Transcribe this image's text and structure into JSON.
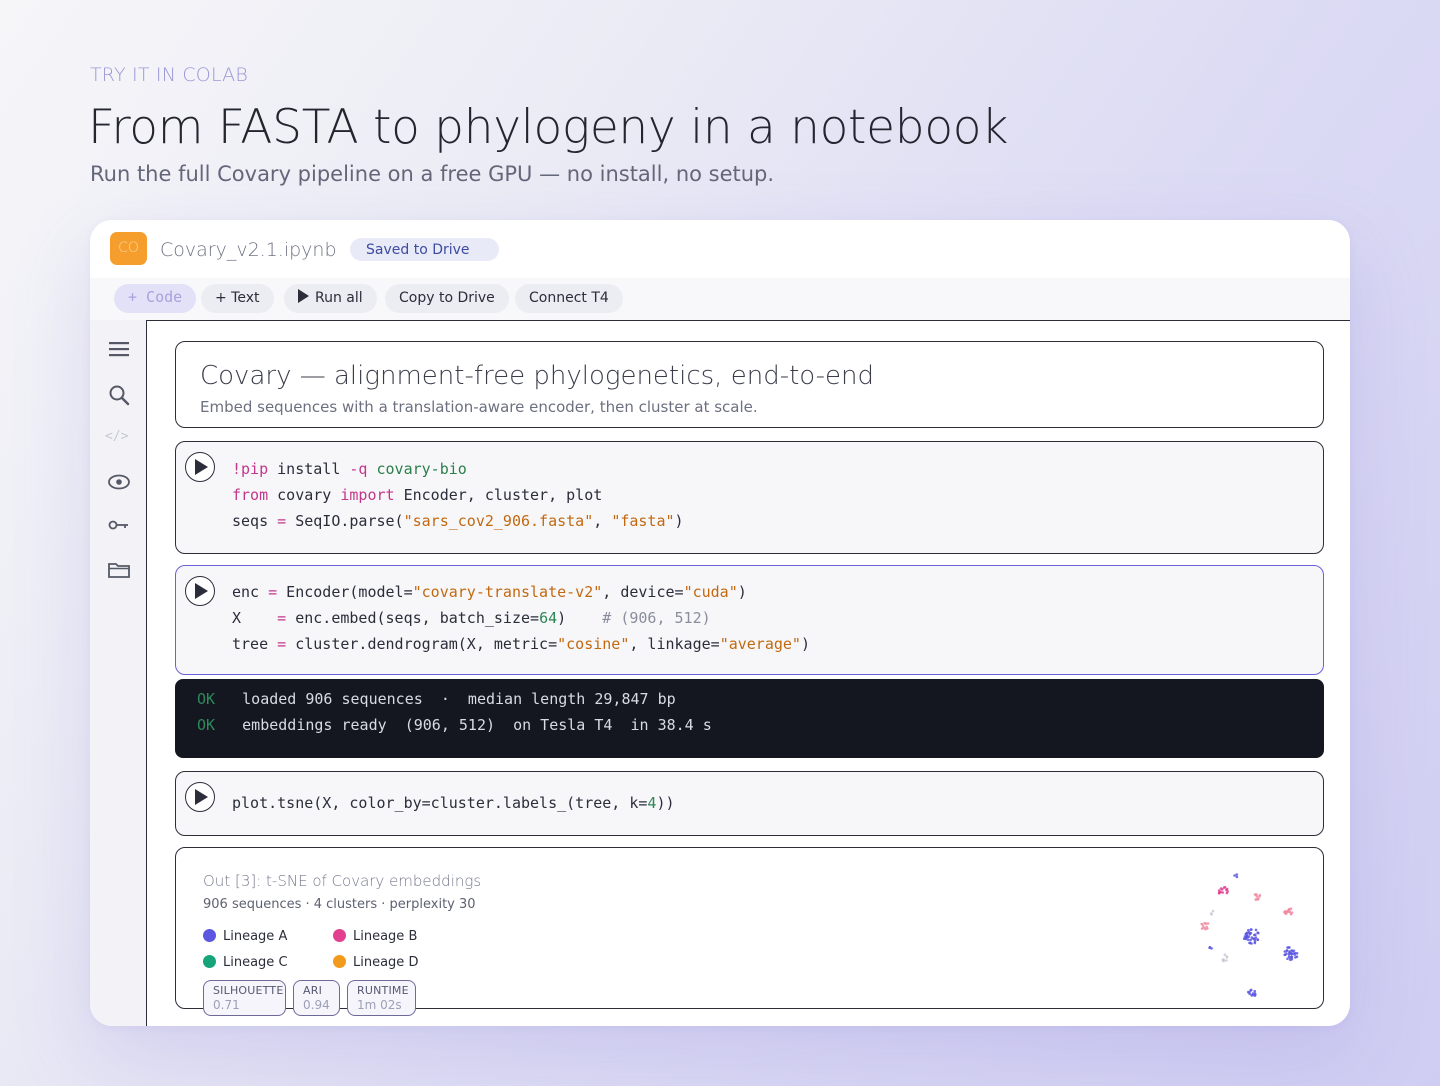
{
  "hero": {
    "eyebrow": "TRY IT IN COLAB",
    "title": "From FASTA to phylogeny in a notebook",
    "subtitle": "Run the full Covary pipeline on a free GPU — no install, no setup."
  },
  "window": {
    "logo": "CO",
    "filename": "Covary_v2.1.ipynb",
    "save_status": "Saved to Drive"
  },
  "toolbar": {
    "code_label": "+ Code",
    "text_label": "+ Text",
    "run_all_label": "Run all",
    "copy_label": "Copy to Drive",
    "connect_label": "Connect  T4"
  },
  "sidebar": {
    "icons": [
      "menu-icon",
      "search-icon",
      "code-snippets-icon",
      "variables-icon",
      "secrets-key-icon",
      "files-folder-icon"
    ],
    "code_glyph": "</>"
  },
  "cells": {
    "markdown": {
      "title": "Covary — alignment-free phylogenetics, end-to-end",
      "subtitle": "Embed sequences with a translation-aware encoder, then cluster at scale."
    },
    "cell1": {
      "lines": [
        [
          {
            "t": "!pip",
            "c": "kw"
          },
          {
            "t": " install ",
            "c": ""
          },
          {
            "t": "-q",
            "c": "kw"
          },
          {
            "t": " ",
            "c": ""
          },
          {
            "t": "covary-bio",
            "c": "fn"
          }
        ],
        [
          {
            "t": "from",
            "c": "kw"
          },
          {
            "t": " covary ",
            "c": ""
          },
          {
            "t": "import",
            "c": "kw"
          },
          {
            "t": " Encoder, cluster, plot",
            "c": ""
          }
        ],
        [
          {
            "t": "seqs ",
            "c": ""
          },
          {
            "t": "=",
            "c": "kw"
          },
          {
            "t": " SeqIO.parse(",
            "c": ""
          },
          {
            "t": "\"sars_cov2_906.fasta\"",
            "c": "str"
          },
          {
            "t": ", ",
            "c": ""
          },
          {
            "t": "\"fasta\"",
            "c": "str"
          },
          {
            "t": ")",
            "c": ""
          }
        ]
      ]
    },
    "cell2": {
      "lines": [
        [
          {
            "t": "enc ",
            "c": ""
          },
          {
            "t": "=",
            "c": "kw"
          },
          {
            "t": " Encoder(model=",
            "c": ""
          },
          {
            "t": "\"covary-translate-v2\"",
            "c": "str"
          },
          {
            "t": ", device=",
            "c": ""
          },
          {
            "t": "\"cuda\"",
            "c": "str"
          },
          {
            "t": ")",
            "c": ""
          }
        ],
        [
          {
            "t": "X    ",
            "c": ""
          },
          {
            "t": "=",
            "c": "kw"
          },
          {
            "t": " enc.embed(seqs, batch_size=",
            "c": ""
          },
          {
            "t": "64",
            "c": "num"
          },
          {
            "t": ")    ",
            "c": ""
          },
          {
            "t": "# (906, 512)",
            "c": "cmt"
          }
        ],
        [
          {
            "t": "tree ",
            "c": ""
          },
          {
            "t": "=",
            "c": "kw"
          },
          {
            "t": " cluster.dendrogram(X, metric=",
            "c": ""
          },
          {
            "t": "\"cosine\"",
            "c": "str"
          },
          {
            "t": ", linkage=",
            "c": ""
          },
          {
            "t": "\"average\"",
            "c": "str"
          },
          {
            "t": ")",
            "c": ""
          }
        ]
      ]
    },
    "output": {
      "lines": [
        {
          "status": "OK",
          "text": "loaded 906 sequences  ·  median length 29,847 bp"
        },
        {
          "status": "OK",
          "text": "embeddings ready  (906, 512)  on Tesla T4  in 38.4 s"
        }
      ]
    },
    "cell3": {
      "lines": [
        [
          {
            "t": "plot.tsne(X, color_by=cluster.labels_(tree, k=",
            "c": ""
          },
          {
            "t": "4",
            "c": "num"
          },
          {
            "t": "))",
            "c": ""
          }
        ]
      ]
    },
    "result": {
      "title": "Out [3]:  t-SNE of Covary embeddings",
      "meta": "906 sequences  ·  4 clusters  ·  perplexity 30",
      "legend": [
        {
          "label": "Lineage A",
          "color": "#5b57e0"
        },
        {
          "label": "Lineage B",
          "color": "#e0408f"
        },
        {
          "label": "Lineage C",
          "color": "#16a57a"
        },
        {
          "label": "Lineage D",
          "color": "#f29a1b"
        }
      ],
      "metrics": [
        {
          "label": "SILHOUETTE",
          "value": "0.71"
        },
        {
          "label": "ARI",
          "value": "0.94"
        },
        {
          "label": "RUNTIME",
          "value": "1m 02s"
        }
      ]
    }
  },
  "colors": {
    "accent": "#6a61d8",
    "orange": "#f59e2e",
    "code_keyword": "#c2378a",
    "code_string": "#c2690f"
  }
}
